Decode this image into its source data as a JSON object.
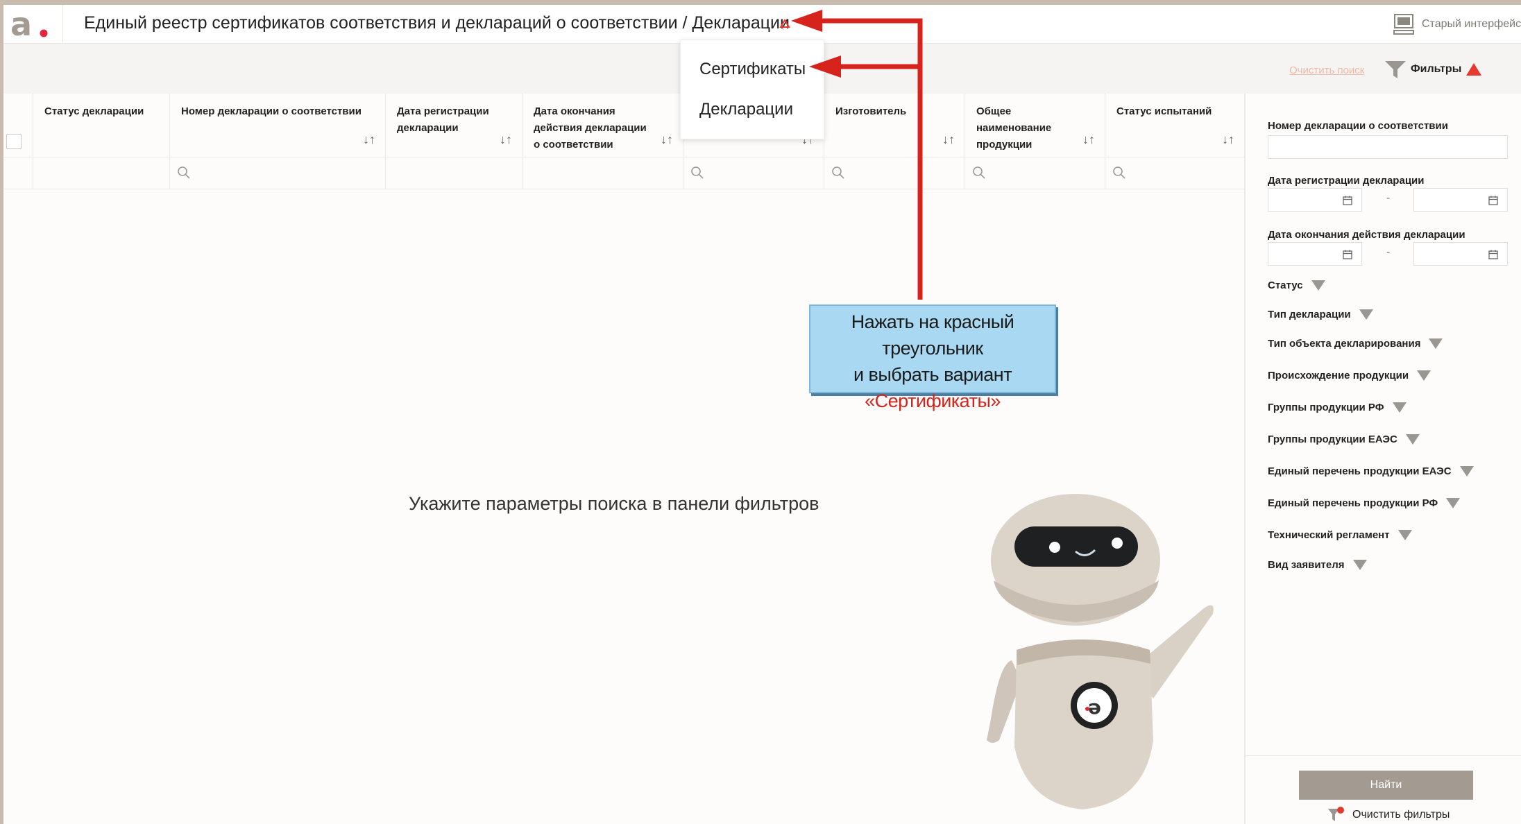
{
  "header": {
    "title": "Единый реестр сертификатов соответствия и деклараций о соответствии / Декларации",
    "old_interface_label": "Старый интерфейс"
  },
  "toolbar": {
    "clear_search": "Очистить поиск",
    "filters_label": "Фильтры"
  },
  "dropdown": {
    "items": [
      "Сертификаты",
      "Декларации"
    ]
  },
  "table": {
    "columns": [
      "Статус декларации",
      "Номер декларации о соответствии",
      "Дата регистрации декларации",
      "Дата окончания действия декларации о соответствии",
      "",
      "Изготовитель",
      "Общее наименование продукции",
      "Статус испытаний"
    ]
  },
  "main": {
    "empty_message": "Укажите параметры поиска в панели фильтров"
  },
  "filters": {
    "decl_number_label": "Номер декларации о соответствии",
    "reg_date_label": "Дата регистрации декларации",
    "end_date_label": "Дата окончания действия декларации",
    "range_separator": "-",
    "dropdowns": [
      "Статус",
      "Тип декларации",
      "Тип объекта декларирования",
      "Происхождение продукции",
      "Группы продукции РФ",
      "Группы продукции ЕАЭС",
      "Единый перечень продукции ЕАЭС",
      "Единый перечень продукции РФ",
      "Технический регламент",
      "Вид заявителя"
    ],
    "find_button": "Найти",
    "clear_filters": "Очистить фильтры"
  },
  "callout": {
    "line1": "Нажать на красный треугольник",
    "line2": "и выбрать вариант",
    "line3": "«Сертификаты»"
  },
  "colors": {
    "accent": "#e8392f",
    "arrow": "#d6241c",
    "callout_bg": "#a9d9f2",
    "find_button": "#a39b92"
  }
}
